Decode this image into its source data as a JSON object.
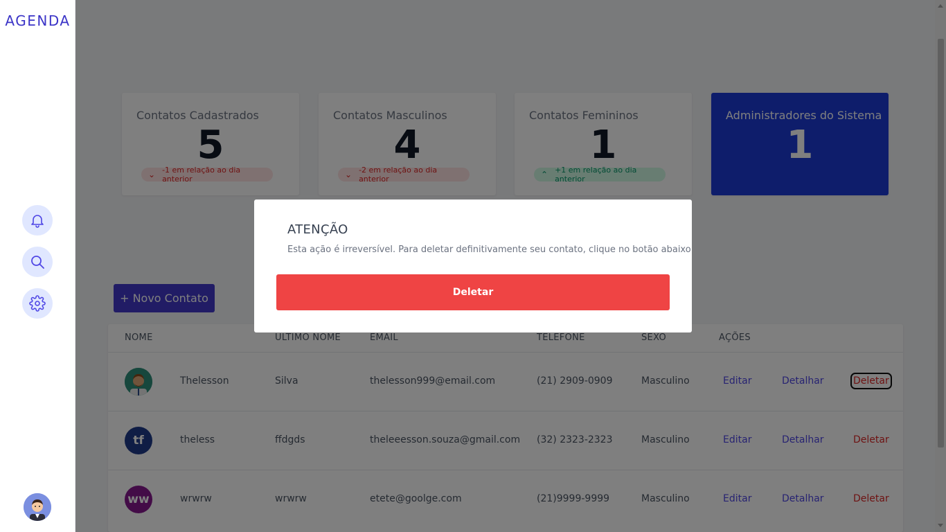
{
  "app": {
    "logo": "AGENDA"
  },
  "sidebar": {
    "icons": [
      "bell-icon",
      "search-icon",
      "gear-icon"
    ]
  },
  "stats": [
    {
      "title": "Contatos Cadastrados",
      "value": "5",
      "badge": "-1 em relação ao dia anterior",
      "trend": "down"
    },
    {
      "title": "Contatos Masculinos",
      "value": "4",
      "badge": "-2 em relação ao dia anterior",
      "trend": "down"
    },
    {
      "title": "Contatos Femininos",
      "value": "1",
      "badge": "+1 em relação ao dia anterior",
      "trend": "up"
    },
    {
      "title": "Administradores do Sistema",
      "value": "1"
    }
  ],
  "actions": {
    "new_contact": "+ Novo Contato"
  },
  "table": {
    "headers": [
      "NOME",
      "ÚLTIMO NOME",
      "EMAIL",
      "TELEFONE",
      "SEXO",
      "AÇÕES"
    ],
    "rows": [
      {
        "avatar": "photo",
        "name": "Thelesson",
        "last_name": "Silva",
        "email": "thelesson999@email.com",
        "phone": "(21) 2909-0909",
        "sex": "Masculino",
        "edit": "Editar",
        "detail": "Detalhar",
        "delete": "Deletar"
      },
      {
        "avatar": "tf",
        "name": "theless",
        "last_name": "ffdgds",
        "email": "theleeesson.souza@gmail.com",
        "phone": "(32) 2323-2323",
        "sex": "Masculino",
        "edit": "Editar",
        "detail": "Detalhar",
        "delete": "Deletar"
      },
      {
        "avatar": "ww",
        "name": "wrwrw",
        "last_name": "wrwrw",
        "email": "etete@goolge.com",
        "phone": "(21)9999-9999",
        "sex": "Masculino",
        "edit": "Editar",
        "detail": "Detalhar",
        "delete": "Deletar"
      }
    ]
  },
  "modal": {
    "title": "ATENÇÃO",
    "message": "Esta ação é irreversível. Para deletar definitivamente seu contato, clique no botão abaixo",
    "confirm": "Deletar"
  },
  "colors": {
    "primary": "#4338ca",
    "admin_card": "#1d3ad6",
    "danger": "#ef4444",
    "avatar_tf": "#1e3a8a",
    "avatar_ww": "#86198f"
  }
}
